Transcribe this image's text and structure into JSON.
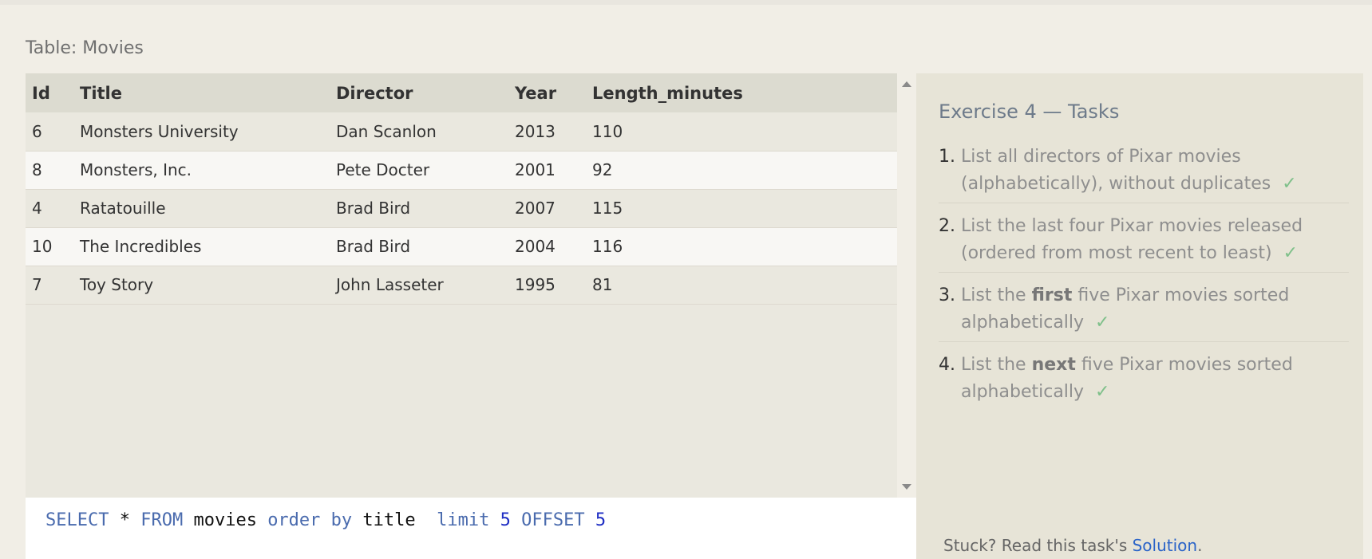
{
  "table_caption": "Table: Movies",
  "results": {
    "columns": [
      "Id",
      "Title",
      "Director",
      "Year",
      "Length_minutes"
    ],
    "rows": [
      [
        "6",
        "Monsters University",
        "Dan Scanlon",
        "2013",
        "110"
      ],
      [
        "8",
        "Monsters, Inc.",
        "Pete Docter",
        "2001",
        "92"
      ],
      [
        "4",
        "Ratatouille",
        "Brad Bird",
        "2007",
        "115"
      ],
      [
        "10",
        "The Incredibles",
        "Brad Bird",
        "2004",
        "116"
      ],
      [
        "7",
        "Toy Story",
        "John Lasseter",
        "1995",
        "81"
      ]
    ]
  },
  "editor": {
    "tokens": [
      {
        "t": "SELECT",
        "c": "kw"
      },
      {
        "t": " * ",
        "c": "plain"
      },
      {
        "t": "FROM",
        "c": "kw"
      },
      {
        "t": " movies ",
        "c": "plain"
      },
      {
        "t": "order by",
        "c": "kw"
      },
      {
        "t": " title  ",
        "c": "plain"
      },
      {
        "t": "limit",
        "c": "kw"
      },
      {
        "t": " ",
        "c": "plain"
      },
      {
        "t": "5",
        "c": "num"
      },
      {
        "t": " ",
        "c": "plain"
      },
      {
        "t": "OFFSET",
        "c": "kw"
      },
      {
        "t": " ",
        "c": "plain"
      },
      {
        "t": "5",
        "c": "num"
      }
    ]
  },
  "tasks": {
    "title": "Exercise 4 — Tasks",
    "items": [
      {
        "num": "1.",
        "parts": [
          {
            "t": "List all directors of Pixar movies (alphabetically), without duplicates"
          }
        ]
      },
      {
        "num": "2.",
        "parts": [
          {
            "t": "List the last four Pixar movies released (ordered from most recent to least)"
          }
        ]
      },
      {
        "num": "3.",
        "parts": [
          {
            "t": "List the "
          },
          {
            "t": "first",
            "b": true
          },
          {
            "t": " five Pixar movies sorted alphabetically"
          }
        ]
      },
      {
        "num": "4.",
        "parts": [
          {
            "t": "List the "
          },
          {
            "t": "next",
            "b": true
          },
          {
            "t": " five Pixar movies sorted alphabetically"
          }
        ]
      }
    ],
    "check_mark": "✓"
  },
  "stuck": {
    "prefix": "Stuck? Read this task's ",
    "link": "Solution",
    "suffix": "."
  },
  "colors": {
    "keyword": "#4a6bae",
    "number": "#1f2ec4",
    "check": "#7fc08a",
    "link": "#2b64c8"
  }
}
